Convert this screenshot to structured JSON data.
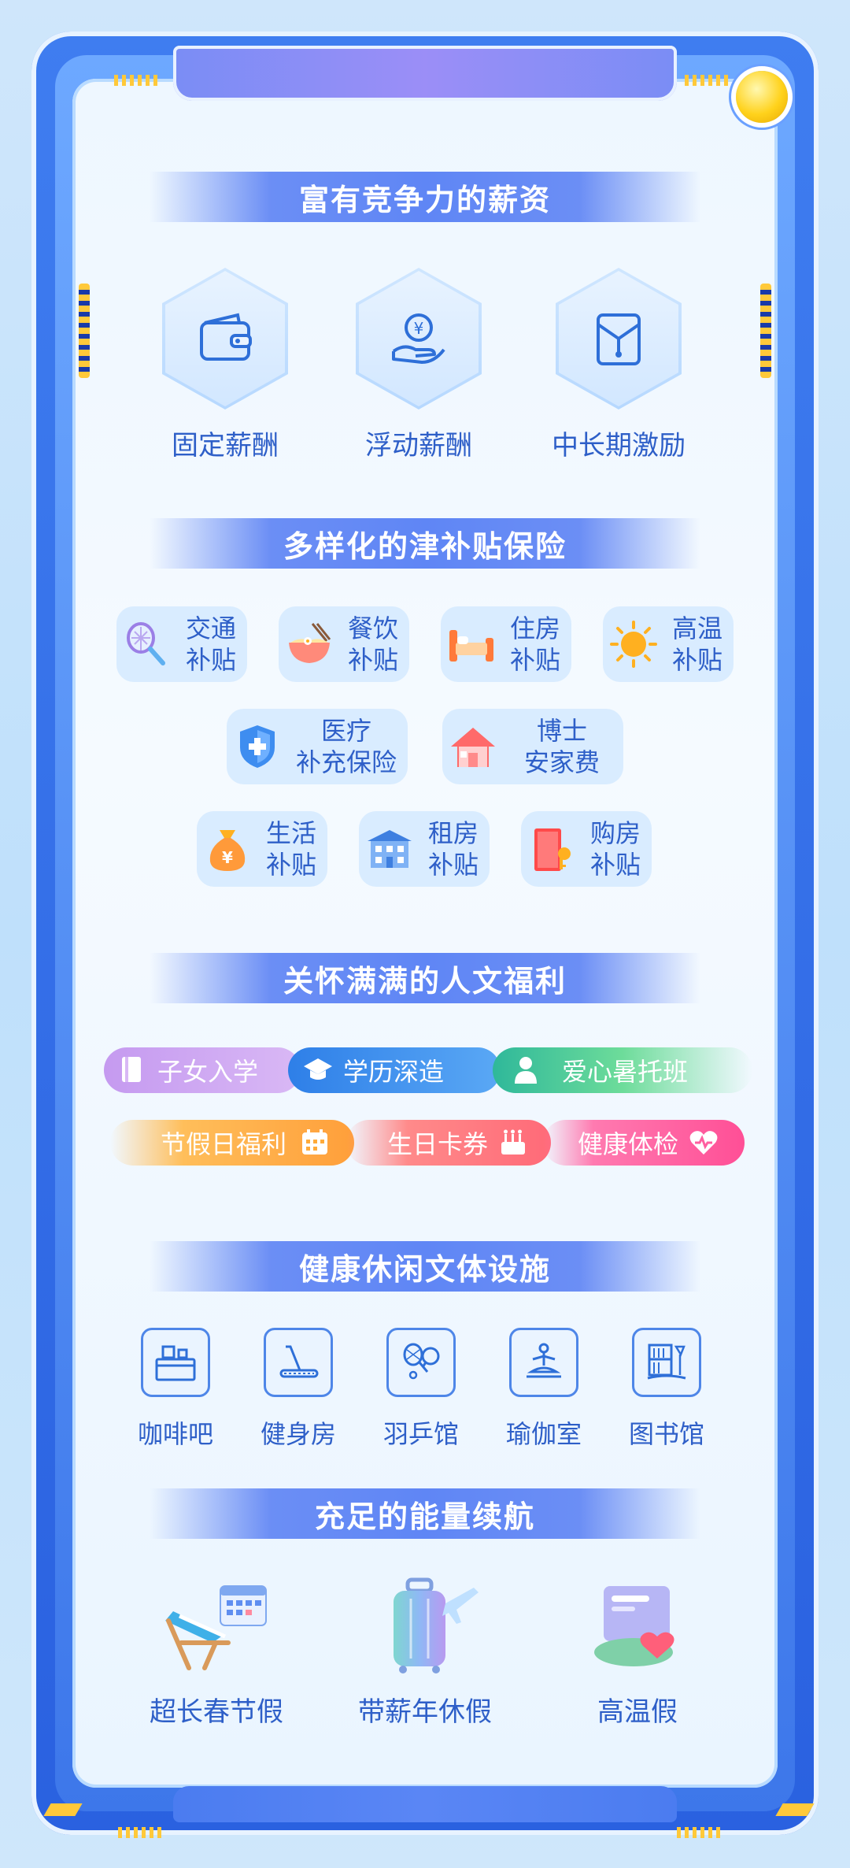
{
  "sections": {
    "salary": {
      "title": "富有竞争力的薪资",
      "items": [
        {
          "label": "固定薪酬",
          "icon": "wallet-icon"
        },
        {
          "label": "浮动薪酬",
          "icon": "yuan-coin-hand-icon"
        },
        {
          "label": "中长期激励",
          "icon": "red-envelope-icon"
        }
      ]
    },
    "allowances": {
      "title": "多样化的津补贴保险",
      "items": [
        {
          "line1": "交通",
          "line2": "补贴",
          "icon": "racket-icon"
        },
        {
          "line1": "餐饮",
          "line2": "补贴",
          "icon": "noodle-bowl-icon"
        },
        {
          "line1": "住房",
          "line2": "补贴",
          "icon": "bed-icon"
        },
        {
          "line1": "高温",
          "line2": "补贴",
          "icon": "sun-icon"
        },
        {
          "line1": "医疗",
          "line2": "补充保险",
          "icon": "medical-shield-icon"
        },
        {
          "line1": "博士",
          "line2": "安家费",
          "icon": "house-icon"
        },
        {
          "line1": "生活",
          "line2": "补贴",
          "icon": "money-bag-icon"
        },
        {
          "line1": "租房",
          "line2": "补贴",
          "icon": "building-icon"
        },
        {
          "line1": "购房",
          "line2": "补贴",
          "icon": "door-key-icon"
        }
      ]
    },
    "welfare": {
      "title": "关怀满满的人文福利",
      "tags": [
        {
          "label": "子女入学",
          "icon": "book-icon",
          "color": "#c59af0"
        },
        {
          "label": "学历深造",
          "icon": "graduation-cap-icon",
          "color": "#3e8df0"
        },
        {
          "label": "爱心暑托班",
          "icon": "person-icon",
          "color": "#3fc7a0"
        },
        {
          "label": "节假日福利",
          "icon": "calendar-icon",
          "color": "#ffab3a"
        },
        {
          "label": "生日卡券",
          "icon": "cake-icon",
          "color": "#ff6f7a"
        },
        {
          "label": "健康体检",
          "icon": "heart-icon",
          "color": "#ff5fa0"
        }
      ]
    },
    "facilities": {
      "title": "健康休闲文体设施",
      "items": [
        {
          "label": "咖啡吧",
          "icon": "coffee-counter-icon"
        },
        {
          "label": "健身房",
          "icon": "treadmill-icon"
        },
        {
          "label": "羽乒馆",
          "icon": "badminton-pingpong-icon"
        },
        {
          "label": "瑜伽室",
          "icon": "yoga-icon"
        },
        {
          "label": "图书馆",
          "icon": "bookshelf-icon"
        }
      ]
    },
    "vacation": {
      "title": "充足的能量续航",
      "items": [
        {
          "label": "超长春节假",
          "icon": "beach-chair-calendar-icon"
        },
        {
          "label": "带薪年休假",
          "icon": "luggage-plane-icon"
        },
        {
          "label": "高温假",
          "icon": "card-heart-icon"
        }
      ]
    }
  },
  "colors": {
    "accent": "#2e5fc8",
    "title_band": "#5f86f5",
    "frame": "#2a61e0",
    "highlight": "#ffc93a"
  }
}
